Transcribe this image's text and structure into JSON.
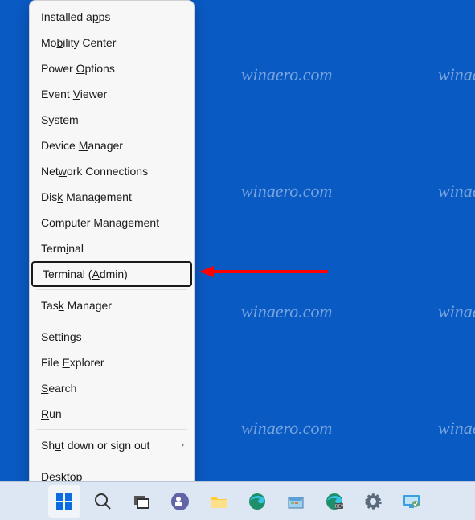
{
  "desktop": {
    "background_color": "#0a5ac4",
    "watermark_text": "winaero.com"
  },
  "menu": {
    "items": [
      {
        "pre": "Installed a",
        "mn": "p",
        "post": "ps"
      },
      {
        "pre": "Mo",
        "mn": "b",
        "post": "ility Center"
      },
      {
        "pre": "Power ",
        "mn": "O",
        "post": "ptions"
      },
      {
        "pre": "Event ",
        "mn": "V",
        "post": "iewer"
      },
      {
        "pre": "S",
        "mn": "y",
        "post": "stem"
      },
      {
        "pre": "Device ",
        "mn": "M",
        "post": "anager"
      },
      {
        "pre": "Net",
        "mn": "w",
        "post": "ork Connections"
      },
      {
        "pre": "Dis",
        "mn": "k",
        "post": " Management"
      },
      {
        "pre": "Computer Mana",
        "mn": "g",
        "post": "ement"
      },
      {
        "pre": "Term",
        "mn": "i",
        "post": "nal"
      },
      {
        "pre": "Terminal (",
        "mn": "A",
        "post": "dmin)",
        "selected": true
      },
      {
        "sep": true
      },
      {
        "pre": "Tas",
        "mn": "k",
        "post": " Manager"
      },
      {
        "sep": true
      },
      {
        "pre": "Setti",
        "mn": "n",
        "post": "gs"
      },
      {
        "pre": "File ",
        "mn": "E",
        "post": "xplorer"
      },
      {
        "pre": "",
        "mn": "S",
        "post": "earch"
      },
      {
        "pre": "",
        "mn": "R",
        "post": "un"
      },
      {
        "sep": true
      },
      {
        "pre": "Sh",
        "mn": "u",
        "post": "t down or sign out",
        "submenu": true
      },
      {
        "sep": true
      },
      {
        "pre": "",
        "mn": "D",
        "post": "esktop"
      }
    ]
  },
  "annotation": {
    "arrow_color": "#ff0000"
  },
  "taskbar": {
    "icons": [
      {
        "name": "start",
        "active": true
      },
      {
        "name": "search"
      },
      {
        "name": "task-view"
      },
      {
        "name": "teams"
      },
      {
        "name": "file-explorer"
      },
      {
        "name": "edge"
      },
      {
        "name": "store-app"
      },
      {
        "name": "edge-dev"
      },
      {
        "name": "settings"
      },
      {
        "name": "remote-app"
      }
    ]
  }
}
